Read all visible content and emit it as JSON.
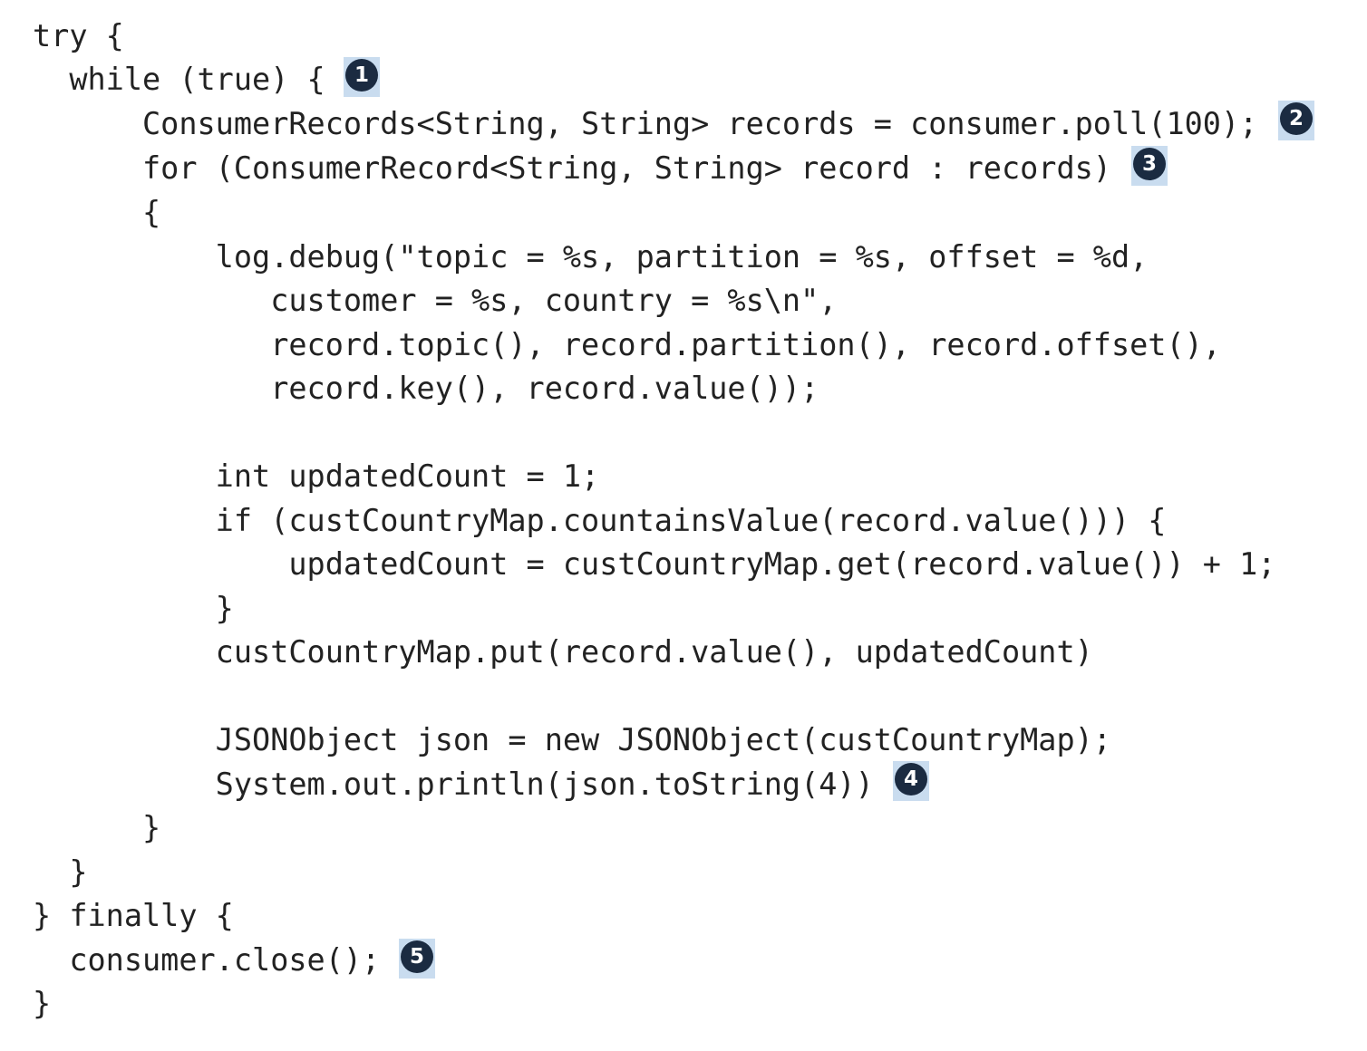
{
  "code": {
    "lines": [
      "try {",
      "  while (true) {",
      "      ConsumerRecords<String, String> records = consumer.poll(100);",
      "      for (ConsumerRecord<String, String> record : records)",
      "      {",
      "          log.debug(\"topic = %s, partition = %s, offset = %d,",
      "             customer = %s, country = %s\\n\",",
      "             record.topic(), record.partition(), record.offset(),",
      "             record.key(), record.value());",
      "",
      "          int updatedCount = 1;",
      "          if (custCountryMap.countainsValue(record.value())) {",
      "              updatedCount = custCountryMap.get(record.value()) + 1;",
      "          }",
      "          custCountryMap.put(record.value(), updatedCount)",
      "",
      "          JSONObject json = new JSONObject(custCountryMap);",
      "          System.out.println(json.toString(4))",
      "      }",
      "  }",
      "} finally {",
      "  consumer.close();",
      "}"
    ]
  },
  "callouts": [
    "1",
    "2",
    "3",
    "4",
    "5"
  ],
  "colors": {
    "text": "#222222",
    "callout_fill": "#1b2b41",
    "callout_highlight": "#c9dcef",
    "background": "#ffffff"
  }
}
